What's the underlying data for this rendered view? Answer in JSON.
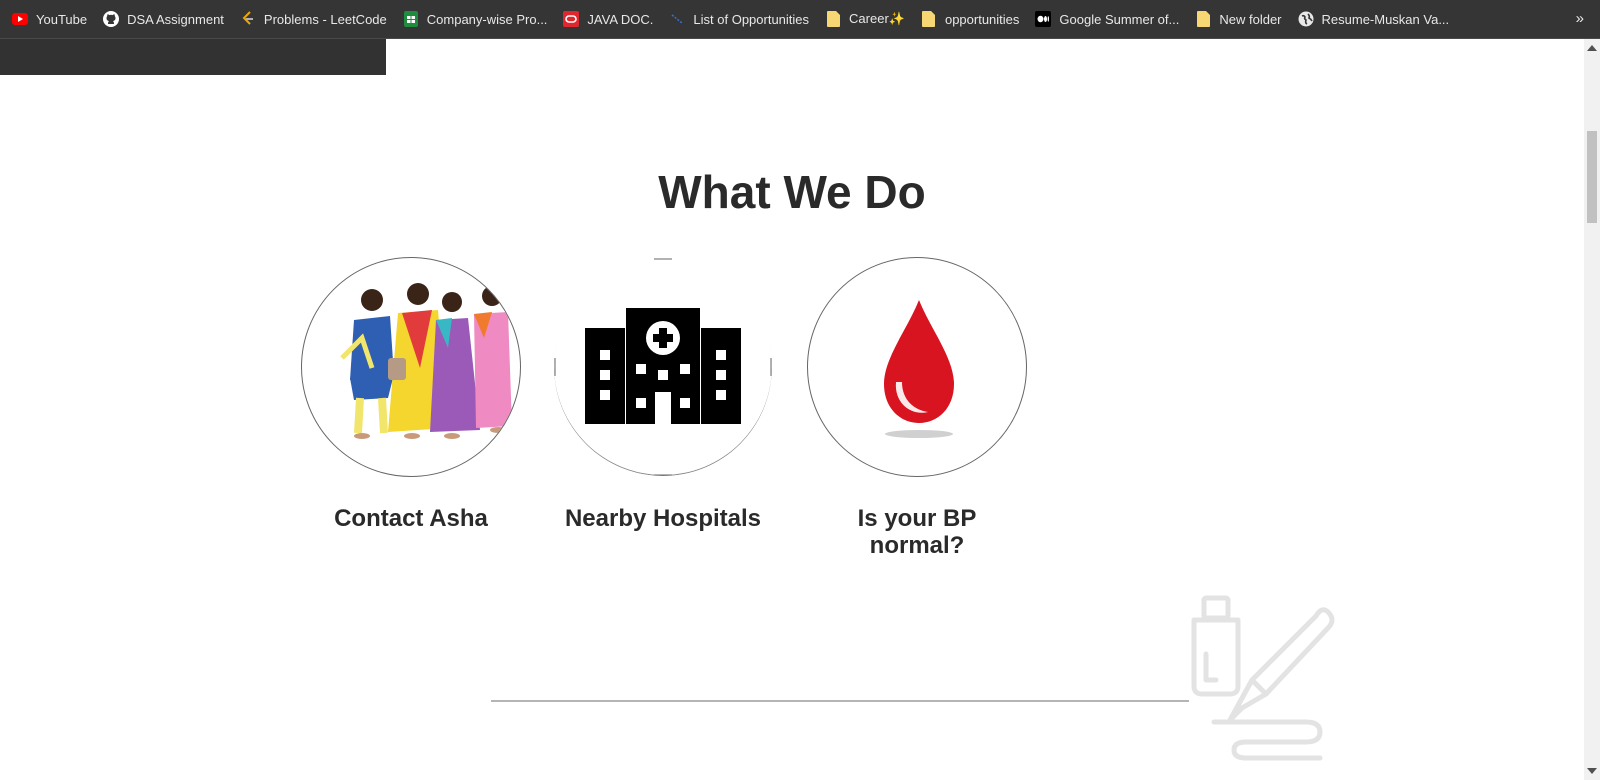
{
  "bookmarks": [
    {
      "label": "YouTube",
      "icon": "youtube-icon"
    },
    {
      "label": "DSA Assignment",
      "icon": "github-icon"
    },
    {
      "label": "Problems - LeetCode",
      "icon": "leetcode-icon"
    },
    {
      "label": "Company-wise Pro...",
      "icon": "sheets-icon"
    },
    {
      "label": "JAVA DOC.",
      "icon": "oracle-icon"
    },
    {
      "label": "List of Opportunities",
      "icon": "link-icon"
    },
    {
      "label": "Career✨",
      "icon": "folder-icon"
    },
    {
      "label": "opportunities",
      "icon": "folder-icon"
    },
    {
      "label": "Google Summer of...",
      "icon": "medium-icon"
    },
    {
      "label": "New folder",
      "icon": "folder-icon"
    },
    {
      "label": "Resume-Muskan Va...",
      "icon": "globe-icon"
    }
  ],
  "bookmarks_more": "»",
  "section": {
    "title": "What We Do",
    "cards": [
      {
        "label": "Contact Asha",
        "icon": "asha-workers-illustration"
      },
      {
        "label": "Nearby Hospitals",
        "icon": "hospital-building-icon"
      },
      {
        "label": "Is your BP normal?",
        "icon": "blood-drop-icon"
      }
    ]
  },
  "decor": {
    "icon": "blood-test-pipette-icon"
  },
  "colors": {
    "bar_bg": "#353535",
    "title_text": "#2a2a2a",
    "blood_red": "#d7141f"
  }
}
